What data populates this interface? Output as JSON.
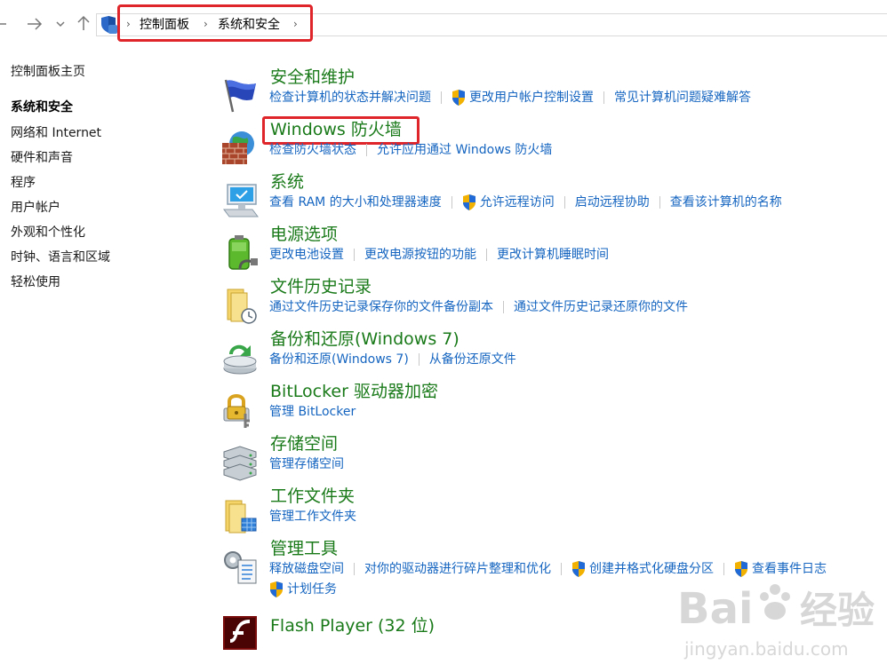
{
  "breadcrumb": {
    "items": [
      "控制面板",
      "系统和安全"
    ]
  },
  "leftnav": {
    "items": [
      {
        "label": "控制面板主页"
      },
      {
        "label": "系统和安全",
        "current": true
      },
      {
        "label": "网络和 Internet"
      },
      {
        "label": "硬件和声音"
      },
      {
        "label": "程序"
      },
      {
        "label": "用户帐户"
      },
      {
        "label": "外观和个性化"
      },
      {
        "label": "时钟、语言和区域"
      },
      {
        "label": "轻松使用"
      }
    ]
  },
  "categories": [
    {
      "title": "安全和维护",
      "icon": "flag-icon",
      "links": [
        {
          "label": "检查计算机的状态并解决问题"
        },
        {
          "label": "更改用户帐户控制设置",
          "shield": true
        },
        {
          "label": "常见计算机问题疑难解答"
        }
      ]
    },
    {
      "title": "Windows 防火墙",
      "icon": "firewall-icon",
      "links": [
        {
          "label": "检查防火墙状态"
        },
        {
          "label": "允许应用通过 Windows 防火墙"
        }
      ]
    },
    {
      "title": "系统",
      "icon": "computer-icon",
      "links": [
        {
          "label": "查看 RAM 的大小和处理器速度"
        },
        {
          "label": "允许远程访问",
          "shield": true
        },
        {
          "label": "启动远程协助"
        },
        {
          "label": "查看该计算机的名称"
        }
      ]
    },
    {
      "title": "电源选项",
      "icon": "power-icon",
      "links": [
        {
          "label": "更改电池设置"
        },
        {
          "label": "更改电源按钮的功能"
        },
        {
          "label": "更改计算机睡眠时间"
        }
      ]
    },
    {
      "title": "文件历史记录",
      "icon": "file-history-icon",
      "links": [
        {
          "label": "通过文件历史记录保存你的文件备份副本"
        },
        {
          "label": "通过文件历史记录还原你的文件"
        }
      ]
    },
    {
      "title": "备份和还原(Windows 7)",
      "icon": "backup-icon",
      "links": [
        {
          "label": "备份和还原(Windows 7)"
        },
        {
          "label": "从备份还原文件"
        }
      ]
    },
    {
      "title": "BitLocker 驱动器加密",
      "icon": "bitlocker-icon",
      "links": [
        {
          "label": "管理 BitLocker"
        }
      ]
    },
    {
      "title": "存储空间",
      "icon": "storage-icon",
      "links": [
        {
          "label": "管理存储空间"
        }
      ]
    },
    {
      "title": "工作文件夹",
      "icon": "work-folders-icon",
      "links": [
        {
          "label": "管理工作文件夹"
        }
      ]
    },
    {
      "title": "管理工具",
      "icon": "admin-tools-icon",
      "links": [
        {
          "label": "释放磁盘空间"
        },
        {
          "label": "对你的驱动器进行碎片整理和优化"
        },
        {
          "label": "创建并格式化硬盘分区",
          "shield": true
        },
        {
          "label": "查看事件日志",
          "shield": true
        }
      ],
      "links2": [
        {
          "label": "计划任务",
          "shield": true
        }
      ]
    },
    {
      "title": "Flash Player (32 位)",
      "icon": "flash-icon",
      "links": []
    }
  ],
  "watermark": {
    "brand": "Bai",
    "brand2": "经验",
    "url": "jingyan.baidu.com"
  },
  "colors": {
    "title_green": "#1a7a1a",
    "link_blue": "#1565c0",
    "highlight_red": "#e0252a"
  }
}
